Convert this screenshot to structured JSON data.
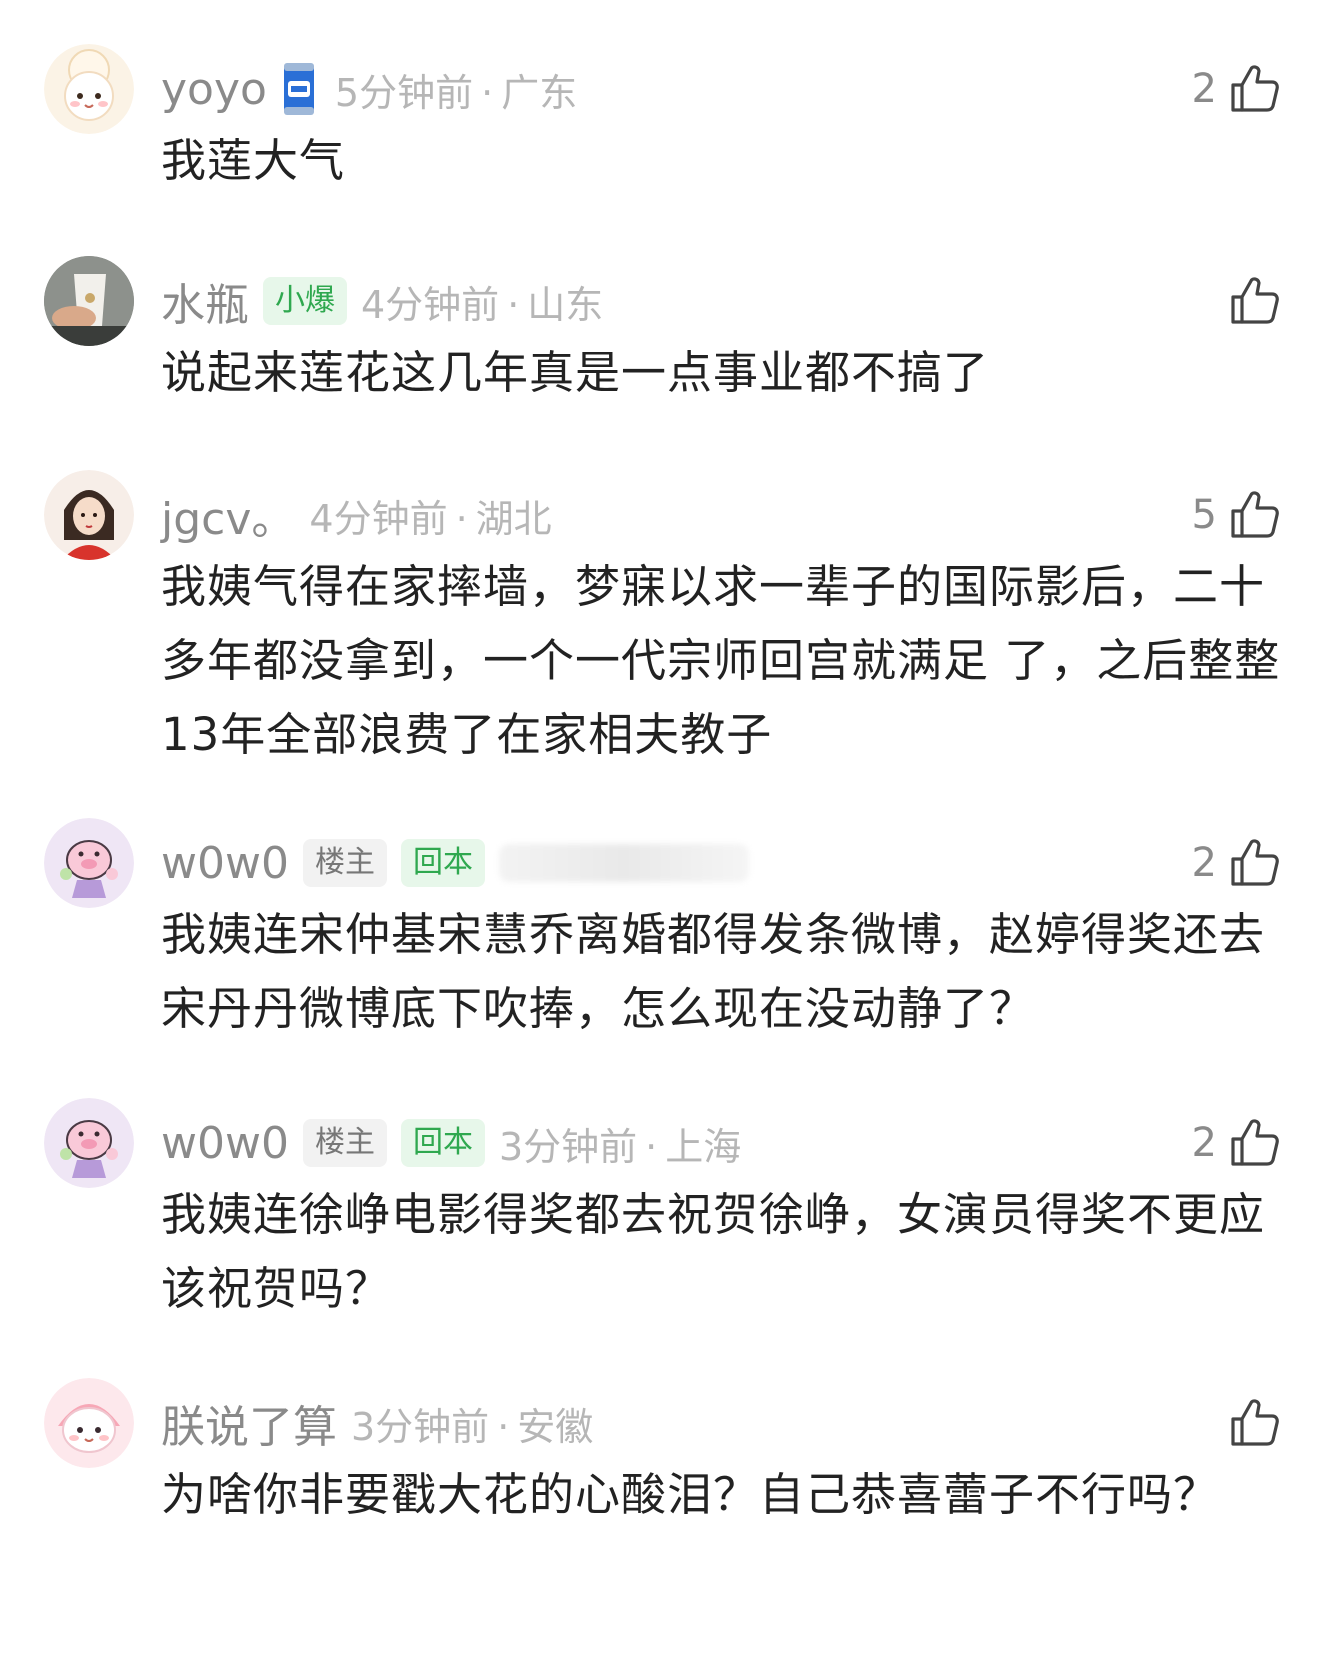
{
  "comments": [
    {
      "username": "yoyo",
      "badge": "blue-can-badge-icon",
      "time": "5分钟前",
      "location": "广东",
      "likes": "2",
      "text": "我莲大气"
    },
    {
      "username": "水瓶",
      "tag": "小爆",
      "time": "4分钟前",
      "location": "山东",
      "likes": "",
      "text": "说起来莲花这几年真是一点事业都不搞了"
    },
    {
      "username": "jgcv。",
      "time": "4分钟前",
      "location": "湖北",
      "likes": "5",
      "text": "我姨气得在家摔墙，梦寐以求一辈子的国际影后，二十多年都没拿到，一个一代宗师回宫就满足 了，之后整整13年全部浪费了在家相夫教子"
    },
    {
      "username": "w0w0",
      "tag_op": "楼主",
      "tag": "回本",
      "likes": "2",
      "text": "我姨连宋仲基宋慧乔离婚都得发条微博，赵婷得奖还去宋丹丹微博底下吹捧，怎么现在没动静了？"
    },
    {
      "username": "w0w0",
      "tag_op": "楼主",
      "tag": "回本",
      "time": "3分钟前",
      "location": "上海",
      "likes": "2",
      "text": "我姨连徐峥电影得奖都去祝贺徐峥，女演员得奖不更应该祝贺吗？"
    },
    {
      "username": "朕说了算",
      "time": "3分钟前",
      "location": "安徽",
      "likes": "",
      "text": "为啥你非要戳大花的心酸泪？自己恭喜蕾子不行吗？"
    }
  ],
  "separator": "·",
  "colors": {
    "username": "#8a8a8a",
    "meta_time": "#b6b6b6",
    "content": "#222222",
    "tag_green_text": "#2fa84f",
    "tag_green_bg": "#e7f7ea",
    "tag_grey_bg": "#f2f2f2"
  }
}
